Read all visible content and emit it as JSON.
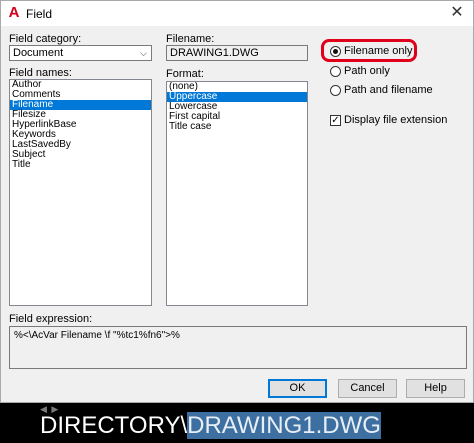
{
  "window": {
    "title": "Field",
    "app_icon": "autocad-icon",
    "close_glyph": "✕"
  },
  "field_category": {
    "label": "Field category:",
    "value": "Document",
    "chevron": "⌵"
  },
  "field_names": {
    "label": "Field names:",
    "items": [
      "Author",
      "Comments",
      "Filename",
      "Filesize",
      "HyperlinkBase",
      "Keywords",
      "LastSavedBy",
      "Subject",
      "Title"
    ],
    "selected": "Filename"
  },
  "filename": {
    "label": "Filename:",
    "value": "DRAWING1.DWG"
  },
  "format": {
    "label": "Format:",
    "items": [
      "(none)",
      "Uppercase",
      "Lowercase",
      "First capital",
      "Title case"
    ],
    "selected": "Uppercase"
  },
  "options": {
    "filename_only": "Filename only",
    "path_only": "Path only",
    "path_and_filename": "Path and filename",
    "selected": "filename_only",
    "display_extension": "Display file extension",
    "display_extension_checked": true
  },
  "field_expression": {
    "label": "Field expression:",
    "value": "%<\\AcVar Filename \\f \"%tc1%fn6\">%"
  },
  "buttons": {
    "ok": "OK",
    "cancel": "Cancel",
    "help": "Help"
  },
  "command_line": {
    "prefix": "DIRECTORY\\",
    "highlighted": "DRAWING1.DWG",
    "arrows": "◀ ▶"
  },
  "colors": {
    "highlight_ring": "#e0001b",
    "selection": "#0078d7"
  }
}
